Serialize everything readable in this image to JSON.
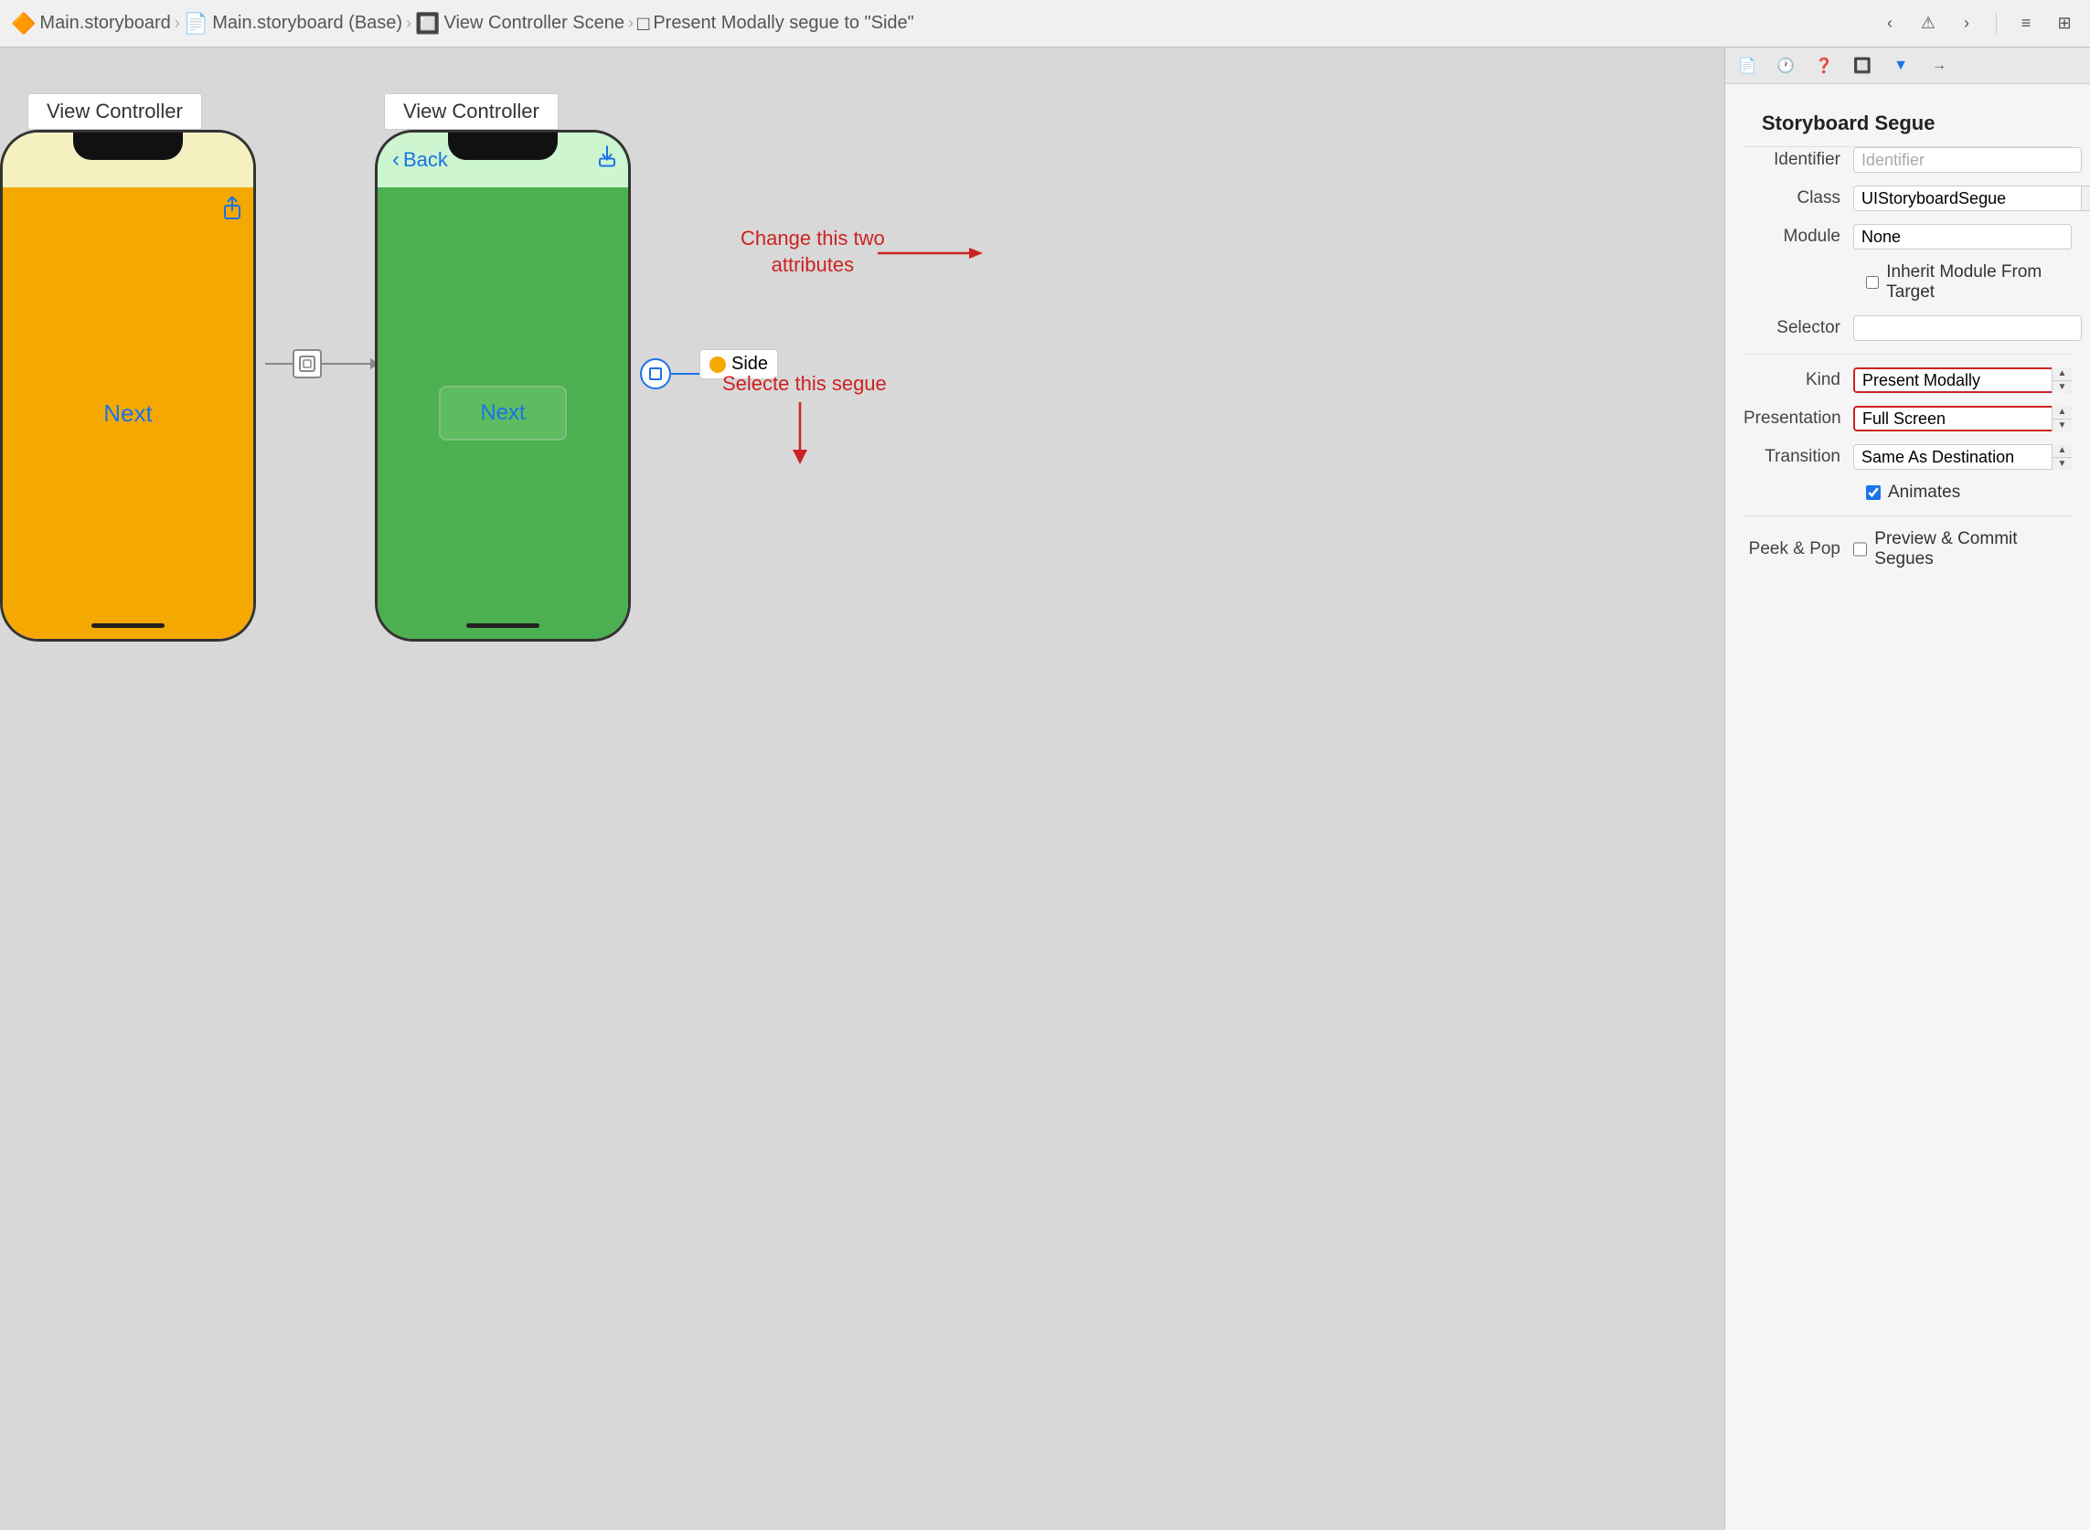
{
  "toolbar": {
    "breadcrumbs": [
      {
        "icon": "file-icon",
        "label": "Main.storyboard"
      },
      {
        "icon": "file-icon",
        "label": "Main.storyboard (Base)"
      },
      {
        "icon": "scene-icon",
        "label": "View Controller Scene"
      },
      {
        "icon": "segue-icon",
        "label": "Present Modally segue to \"Side\""
      }
    ],
    "nav_back": "‹",
    "nav_warning": "⚠",
    "nav_forward": "›"
  },
  "canvas": {
    "left_vc_label": "View Controller",
    "center_vc_label": "View Controller",
    "left_phone": {
      "next_label": "Next"
    },
    "center_phone": {
      "back_label": "Back",
      "next_btn_label": "Next"
    },
    "side_label": "Side",
    "annotation_change": "Change this two\nattributes",
    "annotation_select": "Selecte this segue"
  },
  "panel": {
    "title": "Storyboard Segue",
    "fields": {
      "identifier_label": "Identifier",
      "identifier_placeholder": "Identifier",
      "class_label": "Class",
      "class_value": "UIStoryboardSegue",
      "module_label": "Module",
      "module_value": "None",
      "inherit_module_label": "",
      "inherit_module_checkbox_label": "Inherit Module From Target",
      "selector_label": "Selector",
      "selector_value": "",
      "kind_label": "Kind",
      "kind_value": "Present Modally",
      "presentation_label": "Presentation",
      "presentation_value": "Full Screen",
      "transition_label": "Transition",
      "transition_value": "Same As Destination",
      "animates_label": "",
      "animates_checkbox_label": "Animates",
      "peek_pop_label": "Peek & Pop",
      "preview_commit_label": "Preview & Commit Segues"
    }
  }
}
